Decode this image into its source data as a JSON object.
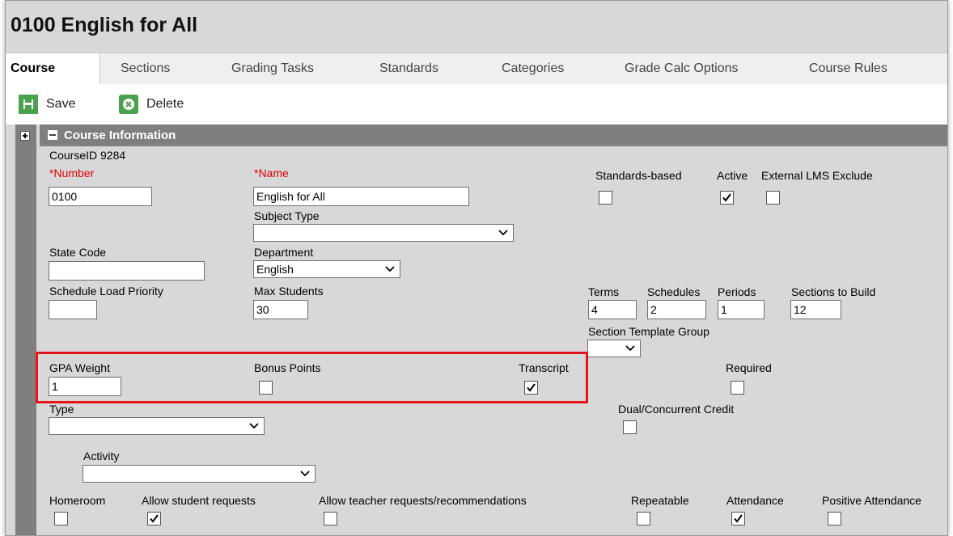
{
  "page": {
    "title": "0100 English for All"
  },
  "tabs": [
    {
      "label": "Course",
      "active": true
    },
    {
      "label": "Sections",
      "active": false
    },
    {
      "label": "Grading Tasks",
      "active": false
    },
    {
      "label": "Standards",
      "active": false
    },
    {
      "label": "Categories",
      "active": false
    },
    {
      "label": "Grade Calc Options",
      "active": false
    },
    {
      "label": "Course Rules",
      "active": false
    }
  ],
  "toolbar": {
    "save_label": "Save",
    "delete_label": "Delete"
  },
  "section": {
    "header": "Course Information",
    "course_id": "CourseID 9284"
  },
  "fields": {
    "number": {
      "label": "*Number",
      "value": "0100"
    },
    "name": {
      "label": "*Name",
      "value": "English for All"
    },
    "subject_type": {
      "label": "Subject Type",
      "value": ""
    },
    "state_code": {
      "label": "State Code",
      "value": ""
    },
    "department": {
      "label": "Department",
      "value": "English"
    },
    "schedule_load_priority": {
      "label": "Schedule Load Priority",
      "value": ""
    },
    "max_students": {
      "label": "Max Students",
      "value": "30"
    },
    "terms": {
      "label": "Terms",
      "value": "4"
    },
    "schedules": {
      "label": "Schedules",
      "value": "2"
    },
    "periods": {
      "label": "Periods",
      "value": "1"
    },
    "sections_to_build": {
      "label": "Sections to Build",
      "value": "12"
    },
    "section_template_group": {
      "label": "Section Template Group",
      "value": ""
    },
    "gpa_weight": {
      "label": "GPA Weight",
      "value": "1"
    },
    "type": {
      "label": "Type",
      "value": ""
    },
    "activity": {
      "label": "Activity",
      "value": ""
    }
  },
  "checkboxes": {
    "standards_based": {
      "label": "Standards-based",
      "checked": false
    },
    "active": {
      "label": "Active",
      "checked": true
    },
    "external_lms_exclude": {
      "label": "External LMS Exclude",
      "checked": false
    },
    "bonus_points": {
      "label": "Bonus Points",
      "checked": false
    },
    "transcript": {
      "label": "Transcript",
      "checked": true
    },
    "required": {
      "label": "Required",
      "checked": false
    },
    "dual_credit": {
      "label": "Dual/Concurrent Credit",
      "checked": false
    },
    "homeroom": {
      "label": "Homeroom",
      "checked": false
    },
    "allow_student_requests": {
      "label": "Allow student requests",
      "checked": true
    },
    "allow_teacher_requests": {
      "label": "Allow teacher requests/recommendations",
      "checked": false
    },
    "repeatable": {
      "label": "Repeatable",
      "checked": false
    },
    "attendance": {
      "label": "Attendance",
      "checked": true
    },
    "positive_attendance": {
      "label": "Positive Attendance",
      "checked": false
    }
  },
  "colors": {
    "header_bg": "#7f7f7f",
    "form_bg": "#d8d8d8",
    "required": "#e00000",
    "highlight": "#e8141c",
    "toolbar_icon": "#4aa24e"
  }
}
